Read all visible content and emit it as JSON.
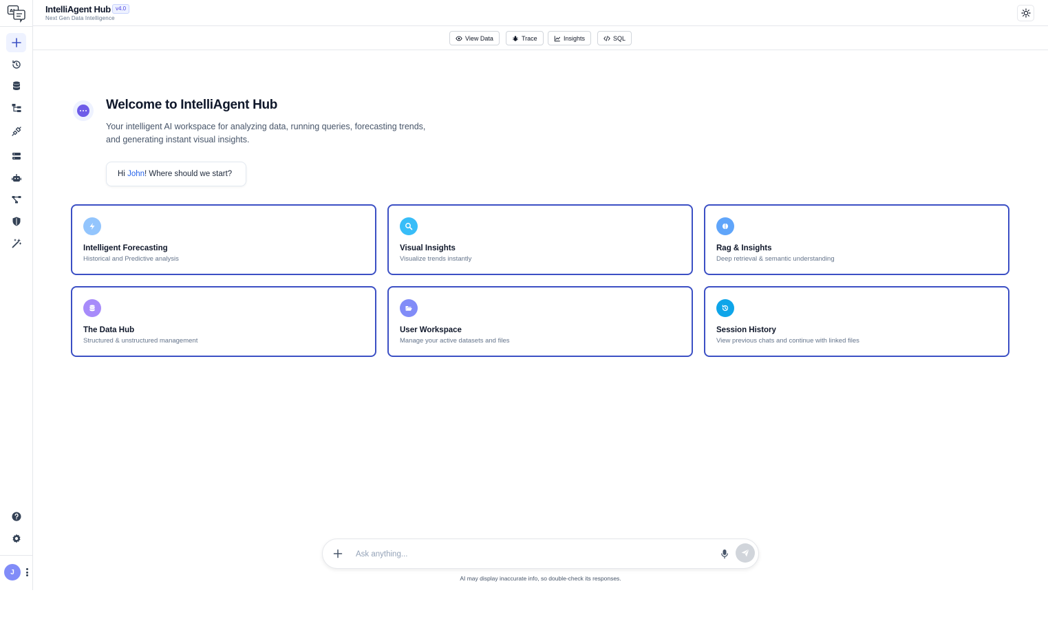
{
  "header": {
    "title": "IntelliAgent Hub",
    "version": "v4.0",
    "subtitle": "Next Gen Data Intelligence"
  },
  "logo": {
    "text": "AI"
  },
  "toolbar": {
    "view_data": "View Data",
    "trace": "Trace",
    "insights": "Insights",
    "sql": "SQL"
  },
  "welcome": {
    "title": "Welcome to IntelliAgent Hub",
    "desc_line1": "Your intelligent AI workspace for analyzing data, running queries, forecasting trends,",
    "desc_line2": "and generating instant visual insights.",
    "greet_prefix": "Hi ",
    "greet_name": "John",
    "greet_suffix": "! Where should we start?"
  },
  "cards": [
    {
      "title": "Intelligent Forecasting",
      "desc": "Historical and Predictive analysis",
      "icon": "bolt-icon",
      "color": "#93c5fd"
    },
    {
      "title": "Visual Insights",
      "desc": "Visualize trends instantly",
      "icon": "search-icon",
      "color": "#38bdf8"
    },
    {
      "title": "Rag & Insights",
      "desc": "Deep retrieval & semantic understanding",
      "icon": "brain-icon",
      "color": "#60a5fa"
    },
    {
      "title": "The Data Hub",
      "desc": "Structured & unstructured management",
      "icon": "database-icon",
      "color": "#a78bfa"
    },
    {
      "title": "User Workspace",
      "desc": "Manage your active datasets and files",
      "icon": "folder-open-icon",
      "color": "#818cf8"
    },
    {
      "title": "Session History",
      "desc": "View previous chats and continue with linked files",
      "icon": "history-icon",
      "color": "#0ea5e9"
    }
  ],
  "chat": {
    "placeholder": "Ask anything...",
    "disclaimer": "AI may display inaccurate info, so double-check its responses."
  },
  "user": {
    "initial": "J"
  },
  "colors": {
    "accent": "#3b4fc4",
    "link": "#2563eb"
  }
}
